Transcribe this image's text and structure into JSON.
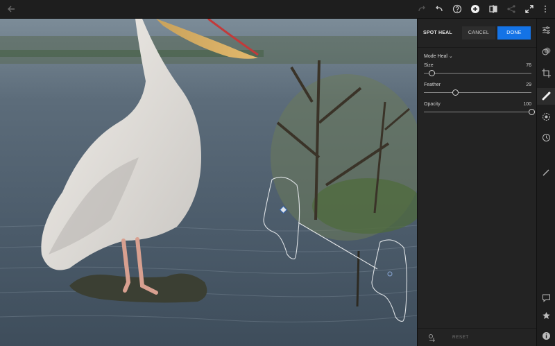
{
  "topbar": {
    "icons": [
      "back-arrow-icon",
      "redo-icon",
      "undo-icon",
      "help-icon",
      "add-icon",
      "compare-icon",
      "share-icon",
      "fullscreen-icon",
      "more-icon"
    ]
  },
  "panel": {
    "title": "SPOT HEAL",
    "cancel_label": "CANCEL",
    "done_label": "DONE",
    "mode_label": "Mode",
    "mode_value": "Heal",
    "sliders": [
      {
        "label": "Size",
        "value": "76",
        "fraction": 0.07
      },
      {
        "label": "Feather",
        "value": "29",
        "fraction": 0.29
      },
      {
        "label": "Opacity",
        "value": "100",
        "fraction": 1.0
      }
    ],
    "reset_label": "RESET"
  },
  "rail": {
    "icons": [
      "edit-sliders-icon",
      "presets-icon",
      "crop-icon",
      "healing-brush-icon",
      "selective-icon",
      "history-icon",
      "brush-icon",
      "comment-icon",
      "star-icon",
      "info-icon"
    ],
    "active": "healing-brush-icon"
  },
  "colors": {
    "accent": "#1473e6",
    "panel_bg": "#232323",
    "bar_bg": "#1e1e1e"
  }
}
